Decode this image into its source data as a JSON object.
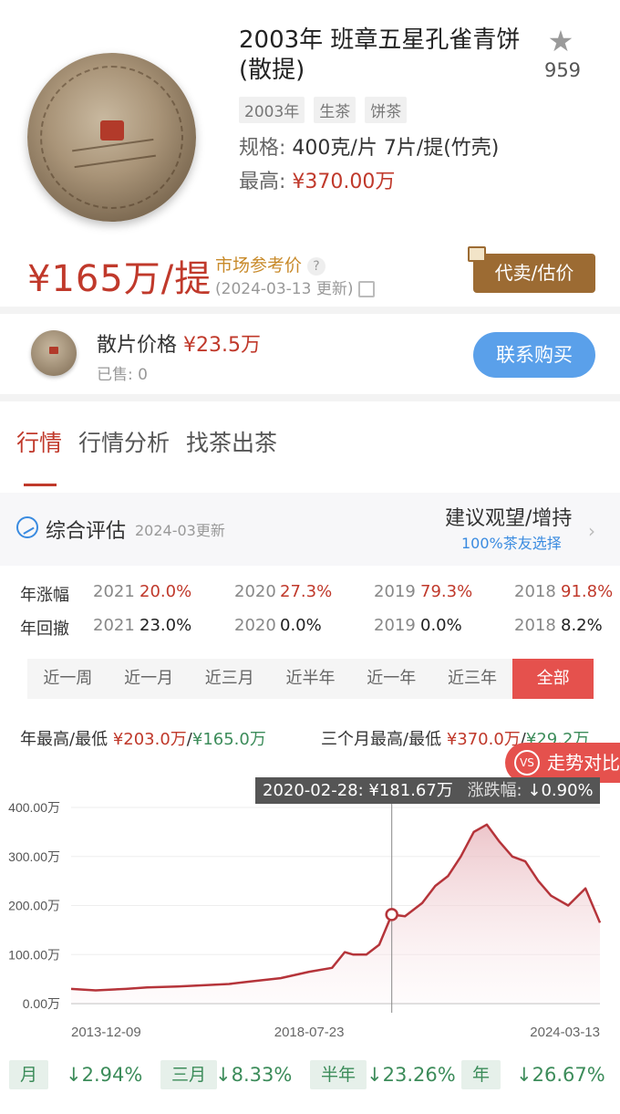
{
  "product": {
    "title": "2003年 班章五星孔雀青饼(散提)",
    "favorites": "959",
    "tags": [
      "2003年",
      "生茶",
      "饼茶"
    ],
    "spec_label": "规格:",
    "spec_value": "400克/片 7片/提(竹壳)",
    "max_label": "最高:",
    "max_value": "¥370.00万"
  },
  "price": {
    "main": "¥165万/提",
    "market_ref": "市场参考价",
    "updated": "(2024-03-13 更新)",
    "consign_button": "代卖/估价"
  },
  "loose": {
    "label": "散片价格",
    "value": "¥23.5万",
    "sold": "已售: 0",
    "contact_button": "联系购买"
  },
  "tabs": [
    "行情",
    "行情分析",
    "找茶出茶"
  ],
  "evaluation": {
    "title": "综合评估",
    "date": "2024-03更新",
    "advice": "建议观望/增持",
    "advice_sub": "100%茶友选择"
  },
  "stats": {
    "rise_label": "年涨幅",
    "rise": [
      {
        "year": "2021",
        "value": "20.0%"
      },
      {
        "year": "2020",
        "value": "27.3%"
      },
      {
        "year": "2019",
        "value": "79.3%"
      },
      {
        "year": "2018",
        "value": "91.8%"
      }
    ],
    "draw_label": "年回撤",
    "draw": [
      {
        "year": "2021",
        "value": "23.0%"
      },
      {
        "year": "2020",
        "value": "0.0%"
      },
      {
        "year": "2019",
        "value": "0.0%"
      },
      {
        "year": "2018",
        "value": "8.2%"
      }
    ]
  },
  "ranges": [
    "近一周",
    "近一月",
    "近三月",
    "近半年",
    "近一年",
    "近三年",
    "全部"
  ],
  "hilo": {
    "year_label": "年最高/最低",
    "year_high": "¥203.0万",
    "year_low": "¥165.0万",
    "q_label": "三个月最高/最低",
    "q_high": "¥370.0万",
    "q_low": "¥29.2万",
    "sep": "/"
  },
  "compare_button": "走势对比",
  "compare_icon_text": "VS",
  "tooltip": {
    "date_price": "2020-02-28: ¥181.67万",
    "change_label": "涨跌幅:",
    "change_value": "↓0.90%"
  },
  "chart_data": {
    "type": "area",
    "ylabels": [
      "400.00万",
      "300.00万",
      "200.00万",
      "100.00万",
      "0.00万"
    ],
    "yticks": [
      400,
      300,
      200,
      100,
      0
    ],
    "ylim": [
      0,
      400
    ],
    "xlabels": [
      "2013-12-09",
      "2018-07-23",
      "2024-03-13"
    ],
    "x": [
      "2013-12-09",
      "2014-06",
      "2015-01",
      "2015-06",
      "2016-01",
      "2016-06",
      "2017-01",
      "2017-06",
      "2018-01",
      "2018-07-23",
      "2019-01",
      "2019-04",
      "2019-06",
      "2019-09",
      "2019-12",
      "2020-02-28",
      "2020-06",
      "2020-10",
      "2021-01",
      "2021-04",
      "2021-07",
      "2021-10",
      "2022-01",
      "2022-04",
      "2022-07",
      "2022-10",
      "2023-01",
      "2023-04",
      "2023-08",
      "2023-12",
      "2024-03-13"
    ],
    "values": [
      30,
      27,
      30,
      33,
      35,
      37,
      40,
      45,
      52,
      65,
      73,
      105,
      100,
      100,
      120,
      181.67,
      178,
      205,
      240,
      260,
      300,
      350,
      365,
      330,
      300,
      290,
      250,
      220,
      200,
      235,
      165
    ],
    "series": [
      {
        "name": "",
        "color": "#b5343a"
      }
    ],
    "highlight_index": 15,
    "grid": true
  },
  "periods": [
    {
      "label": "月",
      "value": "↓2.94%"
    },
    {
      "label": "三月",
      "value": "↓8.33%"
    },
    {
      "label": "半年",
      "value": "↓23.26%"
    },
    {
      "label": "年",
      "value": "↓26.67%"
    }
  ]
}
